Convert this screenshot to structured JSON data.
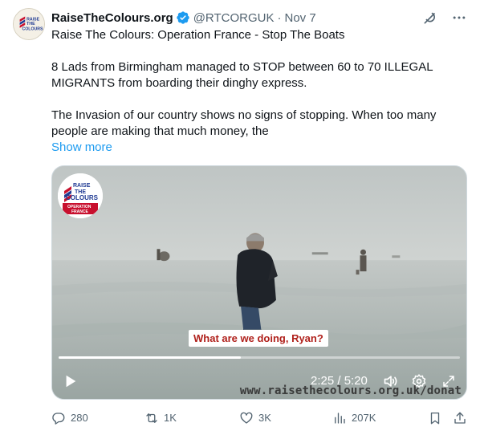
{
  "author": {
    "name": "RaiseTheColours.org",
    "handle": "@RTCORGUK",
    "separator": "·",
    "date": "Nov 7",
    "avatar_text": "RAISE THE COLOURS"
  },
  "tweet": {
    "line1": "Raise The Colours: Operation France - Stop The Boats",
    "line2": "8 Lads from Birmingham managed to STOP between 60 to 70 ILLEGAL MIGRANTS from boarding their dinghy express.",
    "line3": "The Invasion of our country shows no signs of stopping. When too many people are making that much money, the",
    "show_more": "Show more"
  },
  "video": {
    "badge_line1": "RAISE",
    "badge_line2": "THE",
    "badge_line3": "COLOURS",
    "badge_line4": "OPERATION",
    "badge_line5": "FRANCE",
    "caption": "What are we doing, Ryan?",
    "time": "2:25 / 5:20",
    "progress": 0.453,
    "watermark": "www.raisethecolours.org.uk/donat"
  },
  "actions": {
    "replies": "280",
    "reposts": "1K",
    "likes": "3K",
    "views": "207K"
  },
  "colors": {
    "link": "#1d9bf0",
    "verified": "#1d9bf0",
    "muted": "#536471",
    "caption_text": "#b0211c"
  },
  "icons": [
    "verified-badge-icon",
    "grok-icon",
    "more-icon",
    "play-icon",
    "volume-icon",
    "settings-icon",
    "fullscreen-icon",
    "reply-icon",
    "repost-icon",
    "like-icon",
    "views-icon",
    "bookmark-icon",
    "share-icon"
  ]
}
